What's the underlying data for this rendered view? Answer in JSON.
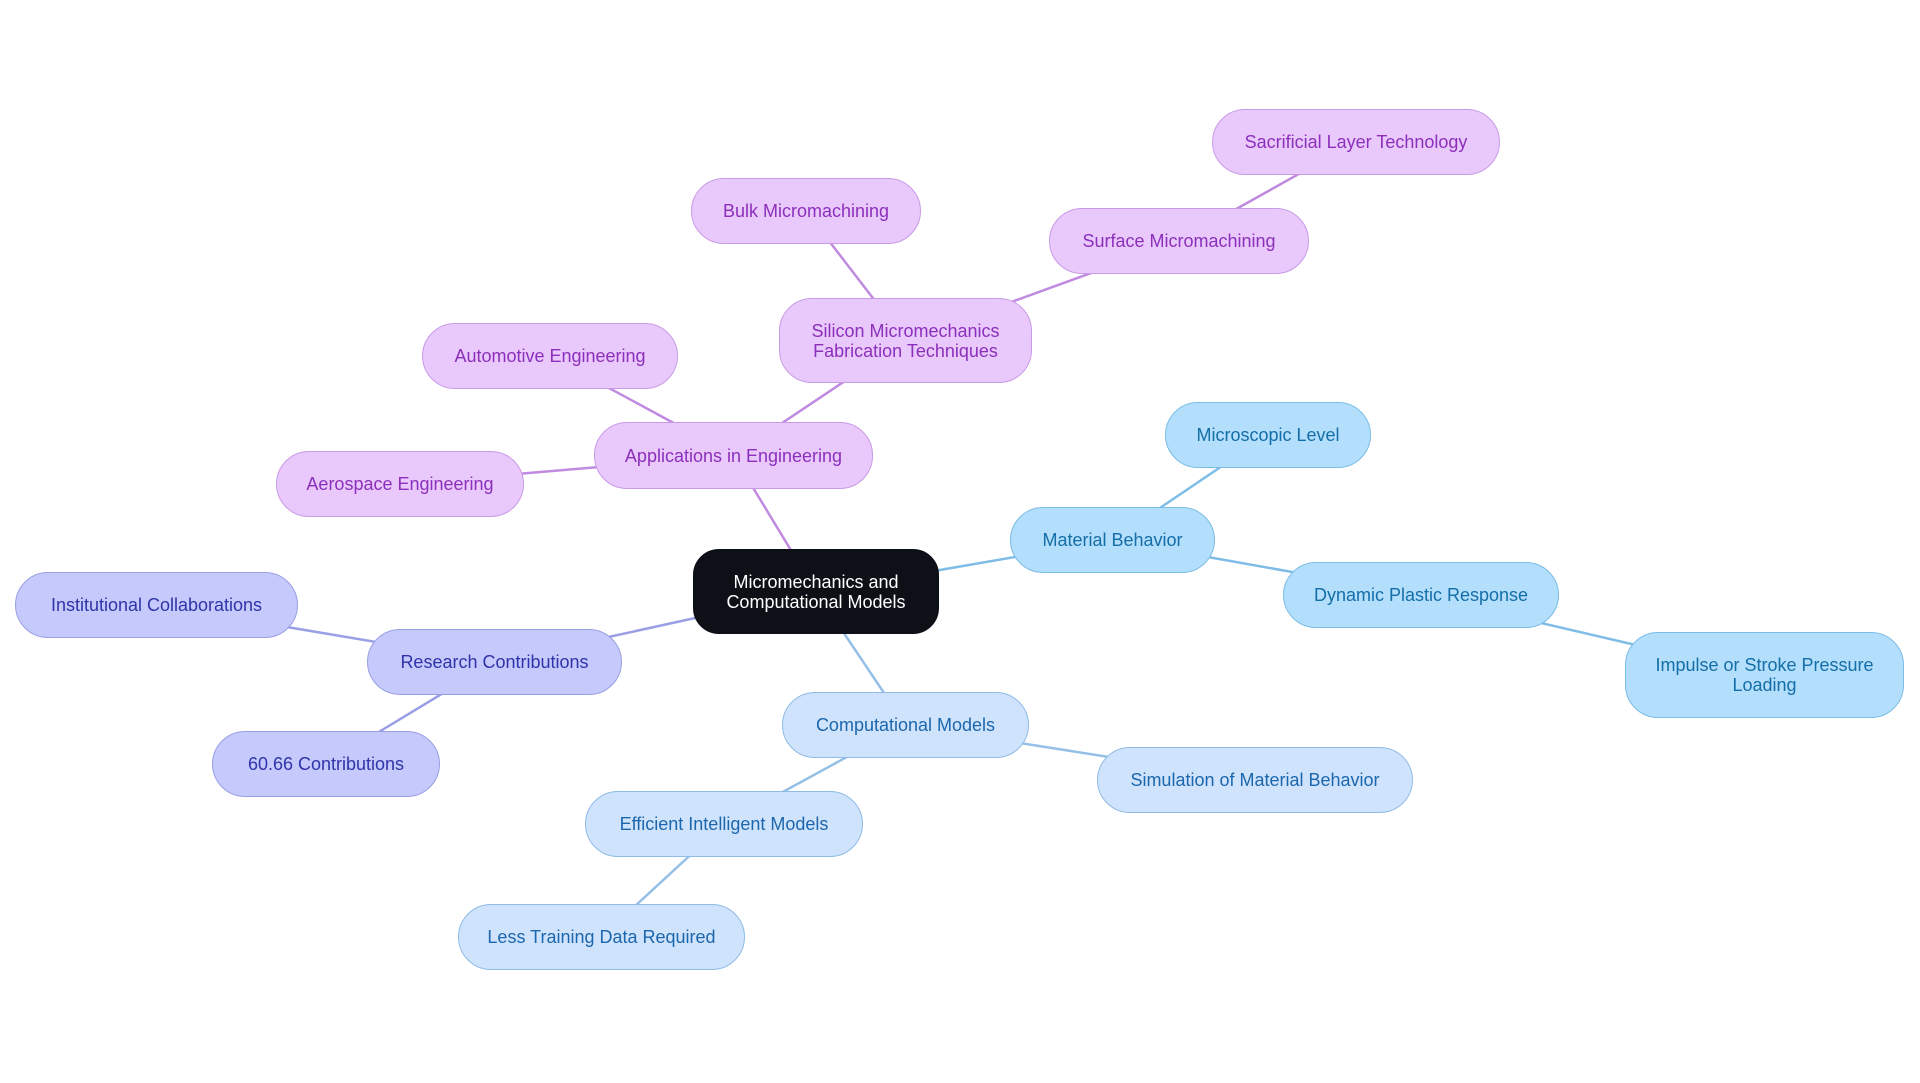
{
  "colors": {
    "purple_edge": "#c08ae0",
    "indigo_edge": "#9a9ee4",
    "blue_edge": "#7fbde6",
    "lightblue_edge": "#94bfe6"
  },
  "mindmap": {
    "root": {
      "id": "root",
      "label": "Micromechanics and Computational Models"
    },
    "nodes": [
      {
        "id": "applications",
        "label": "Applications in Engineering",
        "parent": "root",
        "group": "purple"
      },
      {
        "id": "silicon",
        "label": "Silicon Micromechanics Fabrication Techniques",
        "parent": "applications",
        "group": "purple"
      },
      {
        "id": "bulk",
        "label": "Bulk Micromachining",
        "parent": "silicon",
        "group": "purple"
      },
      {
        "id": "surface",
        "label": "Surface Micromachining",
        "parent": "silicon",
        "group": "purple"
      },
      {
        "id": "sacrificial",
        "label": "Sacrificial Layer Technology",
        "parent": "surface",
        "group": "purple"
      },
      {
        "id": "automotive",
        "label": "Automotive Engineering",
        "parent": "applications",
        "group": "purple"
      },
      {
        "id": "aerospace",
        "label": "Aerospace Engineering",
        "parent": "applications",
        "group": "purple"
      },
      {
        "id": "research",
        "label": "Research Contributions",
        "parent": "root",
        "group": "indigo"
      },
      {
        "id": "institutional",
        "label": "Institutional Collaborations",
        "parent": "research",
        "group": "indigo"
      },
      {
        "id": "contrib",
        "label": "60.66 Contributions",
        "parent": "research",
        "group": "indigo"
      },
      {
        "id": "material",
        "label": "Material Behavior",
        "parent": "root",
        "group": "blue"
      },
      {
        "id": "microscopic",
        "label": "Microscopic Level",
        "parent": "material",
        "group": "blue"
      },
      {
        "id": "dynamic",
        "label": "Dynamic Plastic Response",
        "parent": "material",
        "group": "blue"
      },
      {
        "id": "impulse",
        "label": "Impulse or Stroke Pressure Loading",
        "parent": "dynamic",
        "group": "blue"
      },
      {
        "id": "computational",
        "label": "Computational Models",
        "parent": "root",
        "group": "lightblue"
      },
      {
        "id": "simulation",
        "label": "Simulation of Material Behavior",
        "parent": "computational",
        "group": "lightblue"
      },
      {
        "id": "efficient",
        "label": "Efficient Intelligent Models",
        "parent": "computational",
        "group": "lightblue"
      },
      {
        "id": "lesstraining",
        "label": "Less Training Data Required",
        "parent": "efficient",
        "group": "lightblue"
      }
    ]
  }
}
